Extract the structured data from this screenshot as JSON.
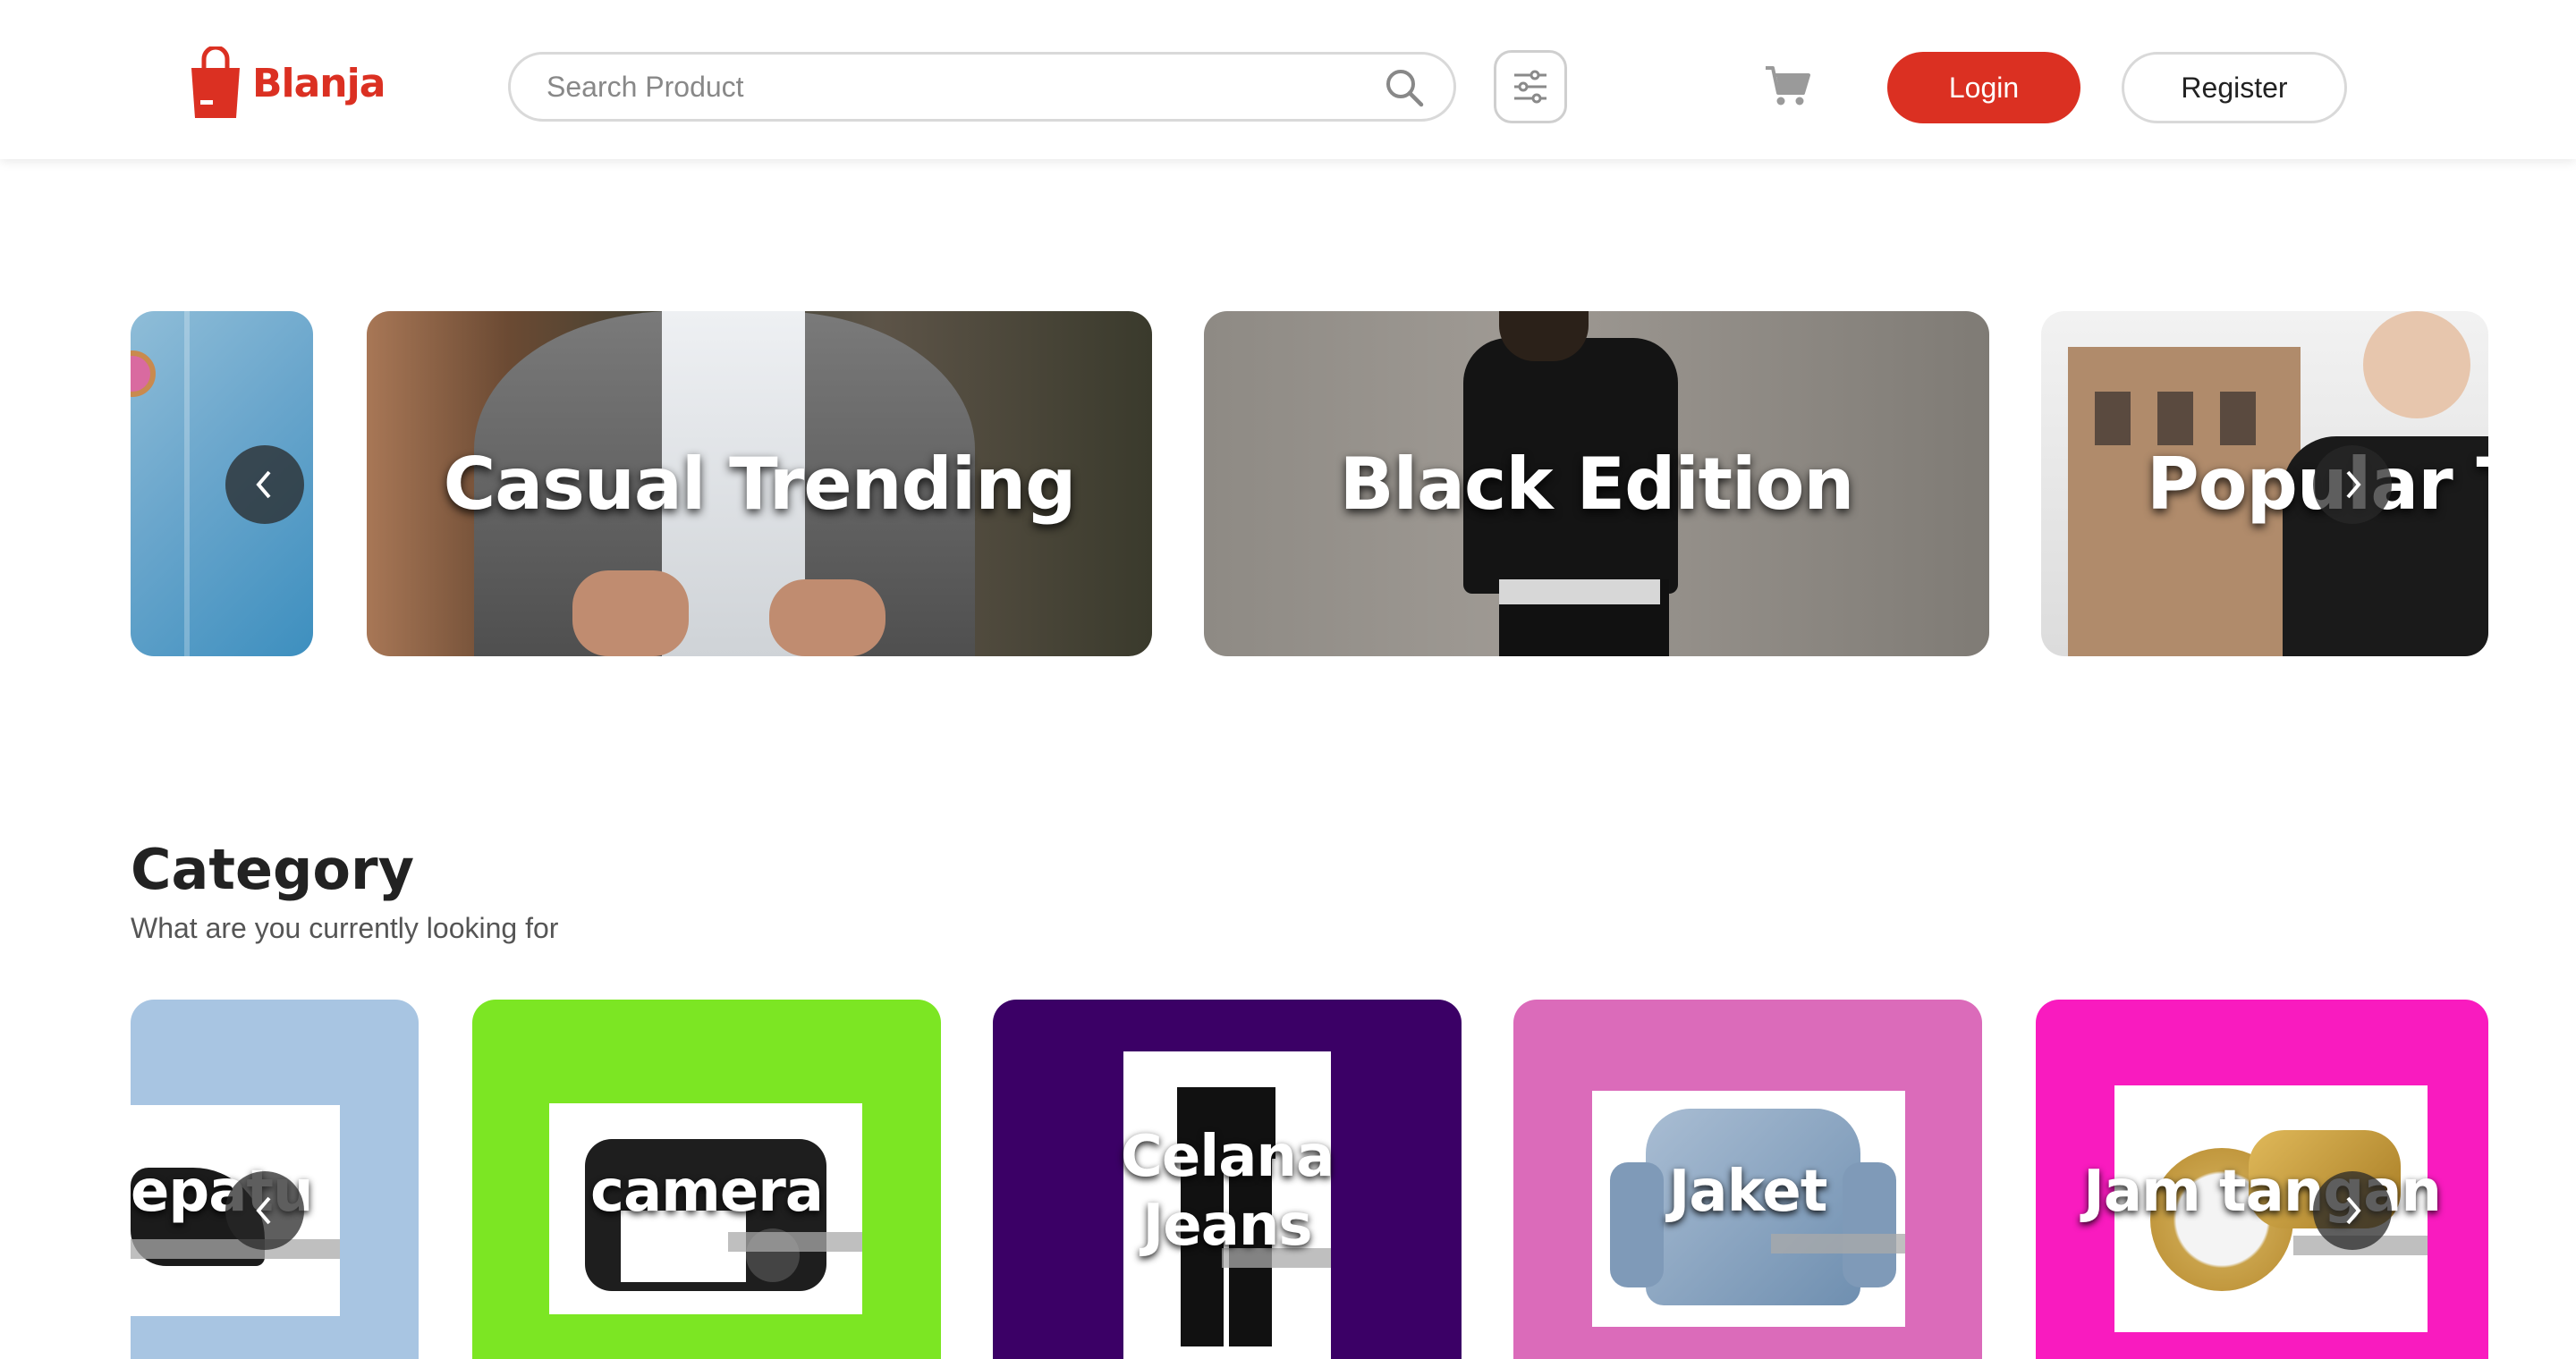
{
  "header": {
    "brand": "Blanja",
    "search_placeholder": "Search Product",
    "login_label": "Login",
    "register_label": "Register",
    "colors": {
      "brand": "#db3022"
    }
  },
  "banners": [
    {
      "title": ""
    },
    {
      "title": "Casual Trending"
    },
    {
      "title": "Black Edition"
    },
    {
      "title": "Popular Te"
    }
  ],
  "category": {
    "title": "Category",
    "subtitle": "What are you currently looking for",
    "items": [
      {
        "label": "epatu",
        "color": "#a8c5e2"
      },
      {
        "label": "camera",
        "color": "#7ce623"
      },
      {
        "label": "Celana Jeans",
        "color": "#3b0066"
      },
      {
        "label": "Jaket",
        "color": "#db6bba"
      },
      {
        "label": "Jam tangan",
        "color": "#f91bbf"
      }
    ]
  }
}
